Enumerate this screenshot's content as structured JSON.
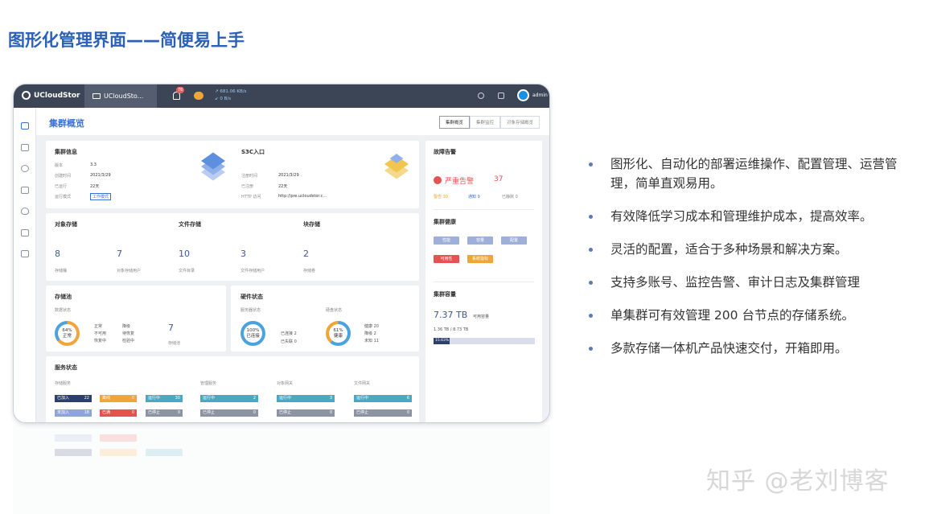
{
  "slide": {
    "title": "图形化管理界面——简便易上手",
    "watermark": "知乎 @老刘博客"
  },
  "bullets": [
    "图形化、自动化的部署运维操作、配置管理、运营管理，简单直观易用。",
    "有效降低学习成本和管理维护成本，提高效率。",
    "灵活的配置，适合于多种场景和解决方案。",
    "支持多账号、监控告警、审计日志及集群管理",
    "单集群可有效管理 200 台节点的存储系统。",
    "多款存储一体机产品快速交付，开箱即用。"
  ],
  "app": {
    "brand": "UCloudStor",
    "open_tab": "UCloudSto...",
    "bell_badge": "76",
    "rate_up": "↗ 681.06 KB/s",
    "rate_down": "↙ 0 B/s",
    "user": "admin",
    "page_title": "集群概览",
    "page_tabs": [
      "集群概览",
      "集群监控",
      "对象存储概览"
    ],
    "cluster_info": {
      "title": "集群信息",
      "rows": [
        {
          "k": "版本",
          "v": "3.3"
        },
        {
          "k": "创建时间",
          "v": "2021/3/29"
        },
        {
          "k": "已运行",
          "v": "22天"
        },
        {
          "k": "运行模式",
          "v": "工作模式"
        }
      ]
    },
    "s3c": {
      "title": "S3C入口",
      "rows": [
        {
          "k": "注册时间",
          "v": "2021/3/29"
        },
        {
          "k": "已注册",
          "v": "22天"
        },
        {
          "k": "HTTP 访问",
          "v": "http://pre.ucloudstor.c..."
        }
      ]
    },
    "storage": {
      "object_title": "对象存储",
      "file_title": "文件存储",
      "block_title": "块存储",
      "items": [
        {
          "value": "8",
          "label": "存储桶"
        },
        {
          "value": "7",
          "label": "对象存储用户"
        },
        {
          "value": "10",
          "label": "文件目录"
        },
        {
          "value": "3",
          "label": "文件存储用户"
        },
        {
          "value": "2",
          "label": "存储卷"
        }
      ]
    },
    "pool": {
      "title": "存储池",
      "data_state": "数据状态",
      "percent": "64%",
      "percent_sub": "正常",
      "legend": [
        "正常",
        "降级",
        "不可用",
        "待恢复",
        "恢复中",
        "检验中"
      ],
      "count": "7",
      "count_label": "存储池"
    },
    "hardware": {
      "title": "硬件状态",
      "server_label": "服务器状态",
      "disk_label": "硬盘状态",
      "server_percent": "100%",
      "server_sub": "已连接",
      "server_legend": [
        "已连接 2",
        "已失联 0"
      ],
      "disk_percent": "61%",
      "disk_sub": "健康",
      "disk_legend": [
        "健康 20",
        "降级 2",
        "未知 11"
      ]
    },
    "services": {
      "title": "服务状态",
      "groups": [
        "存储服务",
        "管理服务",
        "对象网关",
        "文件网关"
      ],
      "storage_bars": [
        {
          "label": "已加入",
          "value": "22"
        },
        {
          "label": "离线",
          "value": "0"
        },
        {
          "label": "运行中",
          "value": "30"
        },
        {
          "label": "未加入",
          "value": "18"
        },
        {
          "label": "已满",
          "value": "0"
        },
        {
          "label": "已停止",
          "value": "0"
        }
      ],
      "mgmt_bars": [
        {
          "label": "运行中",
          "value": "2"
        },
        {
          "label": "已停止",
          "value": "0"
        }
      ],
      "obj_bars": [
        {
          "label": "运行中",
          "value": "3"
        },
        {
          "label": "已停止",
          "value": "0"
        }
      ],
      "file_bars": [
        {
          "label": "运行中",
          "value": "6"
        },
        {
          "label": "已停止",
          "value": "0"
        }
      ]
    },
    "alarm": {
      "title": "故障告警",
      "severe_label": "严重告警",
      "severe_count": "37",
      "warn": "警告 30",
      "notice": "通知 9",
      "ignored": "已静默 0"
    },
    "health": {
      "title": "集群健康",
      "tags": [
        "性能",
        "容量",
        "配置",
        "可用性",
        "系统指标"
      ]
    },
    "capacity": {
      "title": "集群容量",
      "available": "7.37 TB",
      "available_label": "可用容量",
      "used_total": "1.36 TB / 8.73 TB",
      "used_percent": "15.63%",
      "used_fraction": 0.1563
    }
  }
}
